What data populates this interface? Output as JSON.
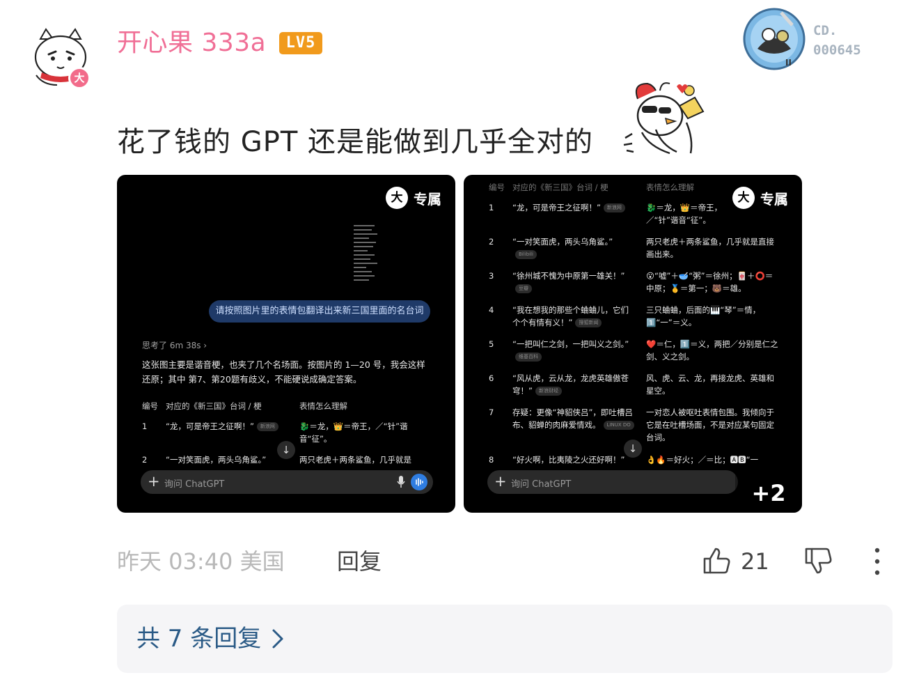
{
  "user": {
    "name": "开心果 333a",
    "level": "LV5",
    "avatar_badge": "大"
  },
  "medal": {
    "line1": "CD.",
    "line2": "000645"
  },
  "comment": {
    "text": "花了钱的 GPT 还是能做到几乎全对的"
  },
  "shot1": {
    "badge_icon": "大",
    "badge_label": "专属",
    "user_prompt": "请按照图片里的表情包翻译出来新三国里面的名台词",
    "thought": "思考了 6m 38s ›",
    "answer": "这张图主要是谐音梗，也夹了几个名场面。按图片的 1—20 号，我会这样还原；其中 第7、第20题有歧义，不能硬说成确定答案。",
    "headers": [
      "编号",
      "对应的《新三国》台词 / 梗",
      "表情怎么理解"
    ],
    "rows": [
      {
        "num": "1",
        "quote": "“龙，可是帝王之征啊！”",
        "chip": "新浪网",
        "meaning": "🐉＝龙，👑＝帝王，／“针”谐音“征”。"
      },
      {
        "num": "2",
        "quote": "“一对笑面虎，两头乌角鲨。”",
        "meaning": "两只老虎＋两条鲨鱼，几乎就是"
      }
    ],
    "input_placeholder": "询问 ChatGPT"
  },
  "shot2": {
    "badge_icon": "大",
    "badge_label": "专属",
    "headers": [
      "编号",
      "对应的《新三国》台词 / 梗",
      "表情怎么理解"
    ],
    "rows": [
      {
        "num": "1",
        "quote": "“龙，可是帝王之征啊！”",
        "chip": "新浪网",
        "meaning": "🐉＝龙，👑＝帝王，／“针”谐音“征”。"
      },
      {
        "num": "2",
        "quote": "“一对笑面虎，两头乌角鲨。”",
        "chip": "Bilibili",
        "meaning": "两只老虎＋两条鲨鱼，几乎就是直接画出来。"
      },
      {
        "num": "3",
        "quote": "“徐州城不愧为中原第一雄关！”",
        "chip": "豆瓣",
        "meaning": "😮“嘘”＋🥣“粥”＝徐州；🀄＋⭕＝中原；🥇＝第一；🐻＝雄。"
      },
      {
        "num": "4",
        "quote": "“我在想我的那些个蛐蛐儿，它们个个有情有义！”",
        "chip": "搜狐新闻",
        "meaning": "三只蛐蛐，后面的🎹“琴”＝情，1️⃣“一”＝义。"
      },
      {
        "num": "5",
        "quote": "“一把叫仁之剑，一把叫义之剑。”",
        "chip": "维基百科",
        "meaning": "❤️＝仁，1️⃣＝义，两把／分别是仁之剑、义之剑。"
      },
      {
        "num": "6",
        "quote": "“风从虎，云从龙，龙虎英雄傲苍穹！”",
        "chip": "新浪财经",
        "meaning": "风、虎、云、龙，再接龙虎、英雄和星空。"
      },
      {
        "num": "7",
        "quote": "存疑：更像“神貂侠吕”，即吐槽吕布、貂蝉的肉麻爱情戏。",
        "chip": "LINUX DO",
        "meaning": "一对恋人被呕吐表情包围。我倾向于它是在吐槽场面，不是对应某句固定台词。"
      },
      {
        "num": "8",
        "quote": "“好火啊，比夷陵之火还好啊！”",
        "meaning": "👌🔥＝好火；／＝比；🅰🅱“一"
      }
    ],
    "input_placeholder": "询问 ChatGPT",
    "more_count": "+2"
  },
  "footer": {
    "time": "昨天 03:40 美国",
    "reply_label": "回复",
    "like_count": "21"
  },
  "replies": {
    "label": "共 7 条回复"
  },
  "colors": {
    "username": "#f06f96",
    "level_badge": "#f19a1c",
    "replies_text": "#2a5a86",
    "voice_button": "#2f7de1"
  }
}
